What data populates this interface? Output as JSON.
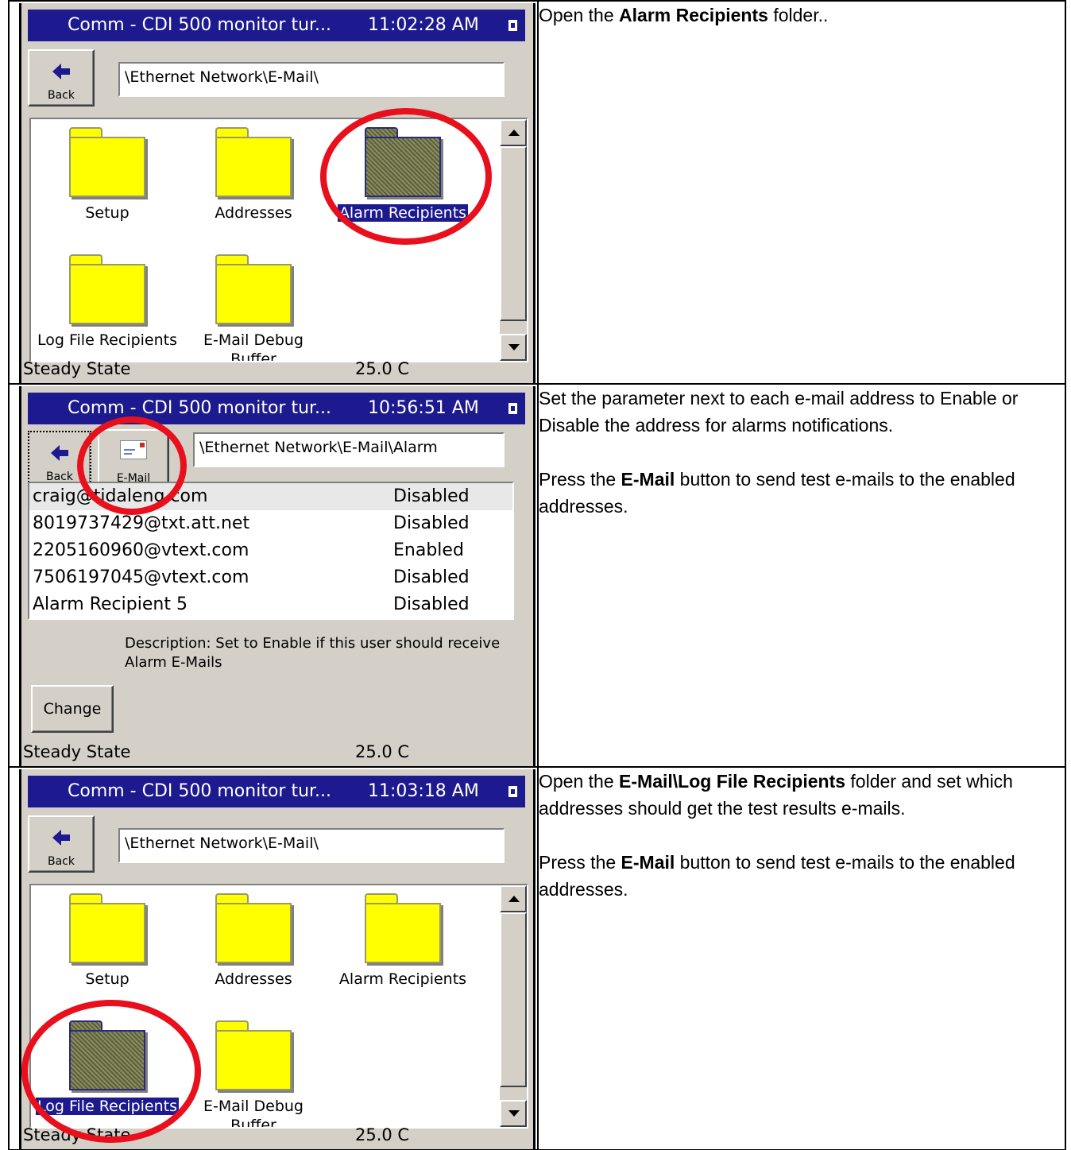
{
  "rows": [
    {
      "screen": {
        "title": "Comm - CDI 500 monitor tur...",
        "time": "11:02:28 AM",
        "back_label": "Back",
        "path": "\\Ethernet Network\\E-Mail\\",
        "folders": [
          {
            "name": "Setup",
            "selected": false
          },
          {
            "name": "Addresses",
            "selected": false
          },
          {
            "name": "Alarm Recipients",
            "selected": true
          },
          {
            "name": "Log File Recipients",
            "selected": false
          },
          {
            "name": "E-Mail Debug",
            "name2": "Buffer",
            "selected": false
          }
        ],
        "status": "Steady State",
        "temp": "25.0 C"
      },
      "note": {
        "p1_pre": "Open the ",
        "p1_bold": "Alarm Recipients",
        "p1_post": " folder.."
      }
    },
    {
      "screen": {
        "title": "Comm - CDI 500 monitor tur...",
        "time": "10:56:51 AM",
        "back_label": "Back",
        "email_label": "E-Mail",
        "path": "\\Ethernet Network\\E-Mail\\Alarm",
        "recipients": [
          {
            "address": "craig@tidaleng.com",
            "value": "Disabled"
          },
          {
            "address": "8019737429@txt.att.net",
            "value": "Disabled"
          },
          {
            "address": "2205160960@vtext.com",
            "value": "Enabled"
          },
          {
            "address": "7506197045@vtext.com",
            "value": "Disabled"
          },
          {
            "address": "Alarm Recipient 5",
            "value": "Disabled"
          }
        ],
        "description": "Description:  Set to Enable if this user should receive Alarm E-Mails",
        "change_label": "Change",
        "status": "Steady State",
        "temp": "25.0 C"
      },
      "note": {
        "p1": "Set the parameter next to each e-mail address to Enable or Disable the address for alarms notifications.",
        "p2_pre": "Press the ",
        "p2_bold": "E-Mail",
        "p2_post": " button to send test e-mails to the enabled addresses."
      }
    },
    {
      "screen": {
        "title": "Comm - CDI 500 monitor tur...",
        "time": "11:03:18 AM",
        "back_label": "Back",
        "path": "\\Ethernet Network\\E-Mail\\",
        "folders": [
          {
            "name": "Setup",
            "selected": false
          },
          {
            "name": "Addresses",
            "selected": false
          },
          {
            "name": "Alarm Recipients",
            "selected": false
          },
          {
            "name": "Log File Recipients",
            "selected": true
          },
          {
            "name": "E-Mail Debug",
            "name2": "Buffer",
            "selected": false
          }
        ],
        "status": "Steady State",
        "temp": "25.0 C"
      },
      "note": {
        "p1_pre": "Open the ",
        "p1_bold": "E-Mail\\Log File Recipients",
        "p1_post": " folder and set which addresses should get the test results e-mails.",
        "p2_pre": "Press the ",
        "p2_bold": "E-Mail",
        "p2_post": " button to send test e-mails to the enabled addresses."
      }
    }
  ],
  "colors": {
    "titlebar": "#1c1a8e",
    "folder": "#ffff00",
    "highlight_circle": "#e8101c"
  }
}
